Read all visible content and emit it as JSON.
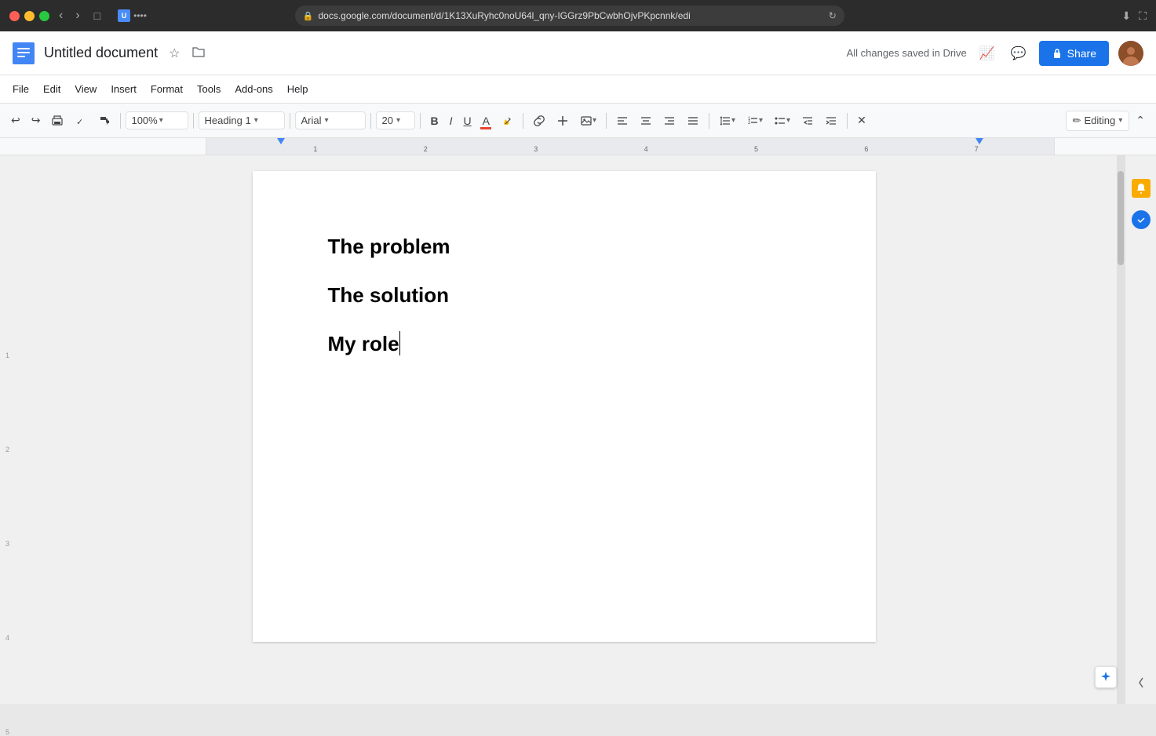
{
  "titlebar": {
    "url": "docs.google.com/document/d/1K13XuRyhc0noU64l_qny-IGGrz9PbCwbhOjvPKpcnnk/edi",
    "nav_back": "‹",
    "nav_forward": "›",
    "tab_dots": "••••"
  },
  "header": {
    "doc_title": "Untitled document",
    "star_label": "☆",
    "folder_label": "⊡",
    "save_status": "All changes saved in Drive",
    "share_label": "Share",
    "editing_label": "Editing"
  },
  "menu": {
    "items": [
      "File",
      "Edit",
      "View",
      "Insert",
      "Format",
      "Tools",
      "Add-ons",
      "Help"
    ]
  },
  "toolbar": {
    "undo": "↩",
    "redo": "↪",
    "print": "⎙",
    "paint_format": "⌅",
    "copy_format": "⌘",
    "zoom": "100%",
    "heading_style": "Heading 1",
    "font": "Arial",
    "font_size": "20",
    "bold": "B",
    "italic": "I",
    "underline": "U",
    "text_color": "A",
    "highlight": "✎",
    "link": "🔗",
    "insert_special": "+",
    "image": "🖼",
    "align_left": "≡",
    "align_center": "≡",
    "align_right": "≡",
    "justify": "≡",
    "numbered_list": "≡",
    "bullet_list": "≡",
    "indent_decrease": "⇤",
    "indent_increase": "⇥",
    "clear_format": "✕",
    "editing_mode": "✏ Editing",
    "collapse": "⌃"
  },
  "document": {
    "headings": [
      {
        "text": "The problem"
      },
      {
        "text": "The solution"
      },
      {
        "text": "My role"
      }
    ],
    "cursor_after": "My role"
  },
  "right_sidebar": {
    "icons": [
      "★",
      "✓"
    ]
  },
  "colors": {
    "accent_blue": "#1a73e8",
    "text_color_bar": "#ea4335",
    "highlight_color": "#fbbc04"
  }
}
